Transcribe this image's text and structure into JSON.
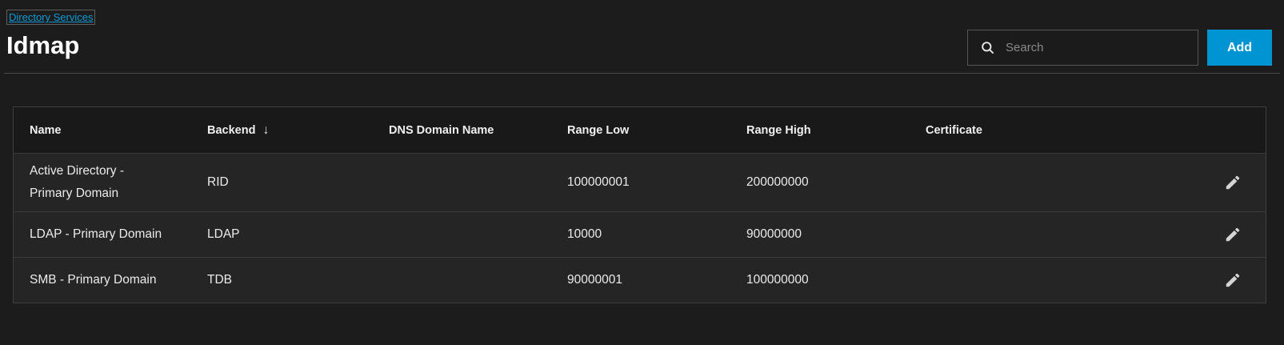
{
  "page": {
    "breadcrumb": "Directory Services",
    "title": "Idmap"
  },
  "toolbar": {
    "search_placeholder": "Search",
    "add_label": "Add"
  },
  "icons": {
    "search": "magnifier",
    "edit": "pencil",
    "sort": "arrow-down"
  },
  "colors": {
    "accent_blue": "#0095d2",
    "link_blue": "#0e9ad7",
    "page_bg": "#1c1c1c",
    "header_bg": "#191919",
    "row_bg": "#252525"
  },
  "table": {
    "columns": [
      "Name",
      "Backend",
      "DNS Domain Name",
      "Range Low",
      "Range High",
      "Certificate"
    ],
    "sort": {
      "column": "Backend",
      "direction": "desc",
      "arrow": "↓"
    },
    "rows": [
      {
        "name": "Active Directory - Primary Domain",
        "backend": "RID",
        "dns_domain_name": "",
        "range_low": "100000001",
        "range_high": "200000000",
        "certificate": ""
      },
      {
        "name": "LDAP - Primary Domain",
        "backend": "LDAP",
        "dns_domain_name": "",
        "range_low": "10000",
        "range_high": "90000000",
        "certificate": ""
      },
      {
        "name": "SMB - Primary Domain",
        "backend": "TDB",
        "dns_domain_name": "",
        "range_low": "90000001",
        "range_high": "100000000",
        "certificate": ""
      }
    ]
  }
}
